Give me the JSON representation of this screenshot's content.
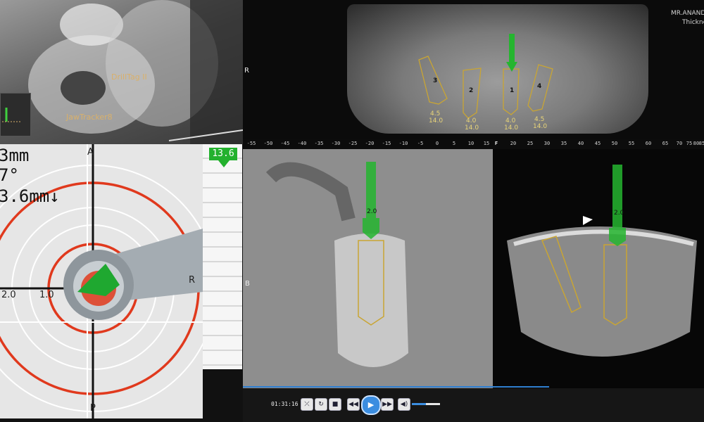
{
  "camera": {
    "labels": [
      "DrillTag II",
      "JawTracker8"
    ]
  },
  "panorama": {
    "patient_line1": "MR.ANAND",
    "patient_line2": "Thickne",
    "side_label": "R",
    "implants": [
      {
        "num": "3",
        "d": "4.5",
        "l": "14.0"
      },
      {
        "num": "2",
        "d": "4.0",
        "l": "14.0"
      },
      {
        "num": "1",
        "d": "4.0",
        "l": "14.0"
      },
      {
        "num": "4",
        "d": "4.5",
        "l": "14.0"
      }
    ]
  },
  "ruler": {
    "ticks": [
      "-55",
      "-50",
      "-45",
      "-40",
      "-35",
      "-30",
      "-25",
      "-20",
      "-15",
      "-10",
      "-5",
      "0",
      "5",
      "10",
      "15",
      "20",
      "25",
      "30",
      "35",
      "40",
      "45",
      "50",
      "55",
      "60",
      "65",
      "70",
      "75",
      "80",
      "85"
    ],
    "letter": "F"
  },
  "target_view": {
    "readout1": "3mm",
    "readout2": "7°",
    "readout3": "3.6mm↓",
    "top_label": "A",
    "right_label": "R",
    "bottom_label": "P",
    "scale_outer": "2.0",
    "scale_inner": "1.0",
    "colors": {
      "ring": "#e0391d",
      "drill": "#1fa830"
    }
  },
  "depth_bar": {
    "value": "13.6"
  },
  "cross_section": {
    "left_label": "B",
    "drill_label": "2.0"
  },
  "axial": {
    "drill_label": "2.0"
  },
  "playback": {
    "time": "01:31:16",
    "progress": 0.72,
    "volume": 0.5
  }
}
